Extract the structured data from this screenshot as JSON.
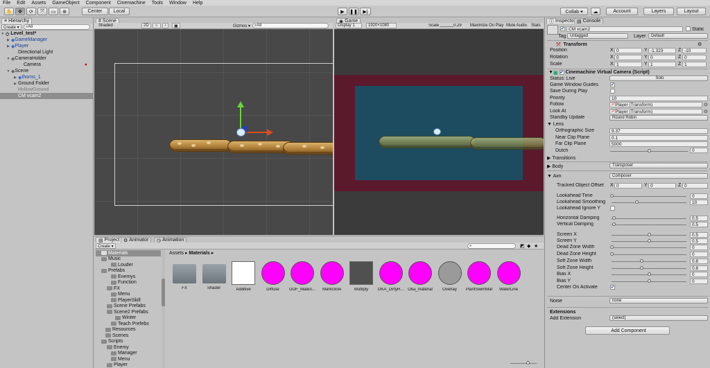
{
  "menu": [
    "File",
    "Edit",
    "Assets",
    "GameObject",
    "Component",
    "Cinemachine",
    "Tools",
    "Window",
    "Help"
  ],
  "toolbar": {
    "pivot": "Center",
    "space": "Local",
    "collab": "Collab ▾",
    "account": "Account",
    "layers": "Layers",
    "layout": "Layout"
  },
  "hierarchy": {
    "tab": "Hierarchy",
    "create": "Create ▾",
    "search_placeholder": "All",
    "items": [
      "Level_test*",
      "GameManager",
      "Player",
      "Directional Light",
      "CameraHolder",
      "Camera",
      "Scene",
      "thorns_1",
      "Ground Folder",
      "HollowGround",
      "CM vcam2"
    ]
  },
  "scene": {
    "tab": "Scene",
    "shading": "Shaded",
    "mode2d": "2D",
    "gizmos": "Gizmos ▾",
    "search_placeholder": "All"
  },
  "game": {
    "tab": "Game",
    "display": "Display 1",
    "resolution": "1920×1080",
    "scale_label": "Scale",
    "scale_value": "0.29",
    "maximize": "Maximize On Play",
    "mute": "Mute Audio",
    "stats": "Stats"
  },
  "project": {
    "tab": "Project",
    "animator_tab": "Animator",
    "animation_tab": "Animation",
    "create": "Create ▾",
    "breadcrumb_root": "Assets",
    "breadcrumb_current": "Materials",
    "tree": [
      "Materials",
      "Music",
      "Louder",
      "Prefabs",
      "Enemys",
      "Function",
      "FX",
      "Menu",
      "PlayerSkill",
      "Scene Prefabs",
      "Scene2 Prefabs",
      "Winter",
      "Teach Prefebs",
      "Resources",
      "Scenes",
      "Scripts",
      "Enemy",
      "Manager",
      "Menu",
      "Player"
    ],
    "assets": [
      {
        "name": "FX",
        "kind": "folder"
      },
      {
        "name": "Shader",
        "kind": "folder"
      },
      {
        "name": "Additive",
        "kind": "white"
      },
      {
        "name": "Diffuse",
        "kind": "pink"
      },
      {
        "name": "DOF_Materi...",
        "kind": "pink"
      },
      {
        "name": "MarkGlow",
        "kind": "pink"
      },
      {
        "name": "Multiply",
        "kind": "dark"
      },
      {
        "name": "OKA_DirtyR...",
        "kind": "pink"
      },
      {
        "name": "Oka_material",
        "kind": "pink"
      },
      {
        "name": "Overlay",
        "kind": "grey"
      },
      {
        "name": "PlantSwimMat",
        "kind": "pink"
      },
      {
        "name": "WaterLine",
        "kind": "pink"
      }
    ]
  },
  "inspector": {
    "tab": "Inspector",
    "console_tab": "Console",
    "object_name": "CM vcam2",
    "static_label": "Static",
    "tag_label": "Tag",
    "tag_value": "Untagged",
    "layer_label": "Layer",
    "layer_value": "Default",
    "transform": {
      "title": "Transform",
      "position_label": "Position",
      "rotation_label": "Rotation",
      "scale_label": "Scale",
      "position": [
        "0",
        "-1.323",
        "-10"
      ],
      "rotation": [
        "0",
        "0",
        "0"
      ],
      "scale": [
        "1",
        "1",
        "1"
      ]
    },
    "vcam": {
      "title": "Cinemachine Virtual Camera (Script)",
      "status_label": "Status: Live",
      "solo": "Solo",
      "game_window_guides": "Game Window Guides",
      "save_during_play": "Save During Play",
      "priority_label": "Priority",
      "priority": "10",
      "follow_label": "Follow",
      "follow": "Player (Transform)",
      "lookat_label": "Look At",
      "lookat": "Player (Transform)",
      "standby_label": "Standby Update",
      "standby": "Round Robin",
      "lens": "Lens",
      "ortho_label": "Orthographic Size",
      "ortho": "9.37",
      "near_label": "Near Clip Plane",
      "near": "0.1",
      "far_label": "Far Clip Plane",
      "far": "5000",
      "dutch_label": "Dutch",
      "dutch": "0",
      "transitions": "Transitions",
      "body_label": "Body",
      "body": "Transposer",
      "aim_label": "Aim",
      "aim": "Composer",
      "tracked_label": "Tracked Object Offset",
      "tracked": [
        "0",
        "0",
        "0"
      ],
      "lookahead_time_label": "Lookahead Time",
      "lookahead_time": "0",
      "lookahead_smooth_label": "Lookahead Smoothing",
      "lookahead_smooth": "10",
      "lookahead_ignore_label": "Lookahead Ignore Y",
      "hdamp_label": "Horizontal Damping",
      "hdamp": "0.5",
      "vdamp_label": "Vertical Damping",
      "vdamp": "0.5",
      "screenx_label": "Screen X",
      "screenx": "0.5",
      "screeny_label": "Screen Y",
      "screeny": "0.5",
      "deadw_label": "Dead Zone Width",
      "deadw": "0",
      "deadh_label": "Dead Zone Height",
      "deadh": "0",
      "softw_label": "Soft Zone Width",
      "softw": "0.8",
      "softh_label": "Soft Zone Height",
      "softh": "0.8",
      "biasx_label": "Bias X",
      "biasx": "0",
      "biasy_label": "Bias Y",
      "biasy": "0",
      "center_label": "Center On Activate",
      "noise_label": "Noise",
      "noise": "none",
      "extensions": "Extensions",
      "add_ext_label": "Add Extension",
      "add_ext": "(select)"
    },
    "add_component": "Add Component"
  },
  "colors": {
    "selection": "#3e6fc2",
    "pink": "#ff00ff",
    "game_outer": "#5a1a2c",
    "game_inner": "#1d4c60"
  }
}
